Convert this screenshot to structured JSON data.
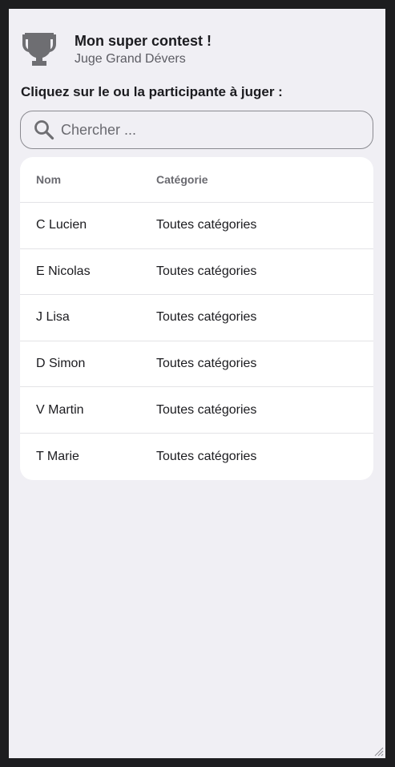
{
  "header": {
    "title": "Mon super contest !",
    "subtitle": "Juge Grand Dévers",
    "icon": "trophy-icon"
  },
  "instruction": "Cliquez sur le ou la participante à juger :",
  "search": {
    "placeholder": "Chercher ...",
    "value": "",
    "icon": "search-icon"
  },
  "table": {
    "columns": [
      "Nom",
      "Catégorie"
    ],
    "rows": [
      {
        "name": "C Lucien",
        "category": "Toutes catégories"
      },
      {
        "name": "E Nicolas",
        "category": "Toutes catégories"
      },
      {
        "name": "J Lisa",
        "category": "Toutes catégories"
      },
      {
        "name": "D Simon",
        "category": "Toutes catégories"
      },
      {
        "name": "V Martin",
        "category": "Toutes catégories"
      },
      {
        "name": "T Marie",
        "category": "Toutes catégories"
      }
    ]
  },
  "colors": {
    "background": "#f0eff4",
    "frame": "#1d1d1f",
    "card": "#ffffff",
    "icon": "#6e6e72"
  }
}
